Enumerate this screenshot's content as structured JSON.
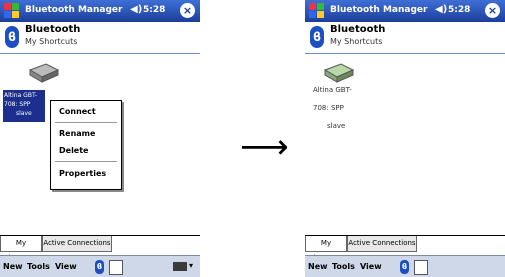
{
  "app": {
    "title": "Bluetooth Manager",
    "clock": "5:28",
    "volume_icon": "speaker-icon",
    "close_label": "×"
  },
  "header": {
    "title": "Bluetooth",
    "subtitle": "My Shortcuts"
  },
  "left": {
    "selected_label_line1": "Altina GBT-",
    "selected_label_line2": "708: SPP",
    "selected_label_line3": "slave",
    "menu": [
      "Connect",
      "Rename",
      "Delete",
      "Properties"
    ]
  },
  "right": {
    "label_line1": "Altina GBT-",
    "label_line2": "708: SPP",
    "label_line3": "slave"
  },
  "tabs": [
    "My Shortcuts",
    "Active Connections"
  ],
  "menubar": [
    "New",
    "Tools",
    "View"
  ],
  "arrow": "⟶",
  "colors": {
    "title_bar": "#1c3e9a",
    "selection": "#1c2f8c",
    "menubar": "#cfd8e8"
  }
}
